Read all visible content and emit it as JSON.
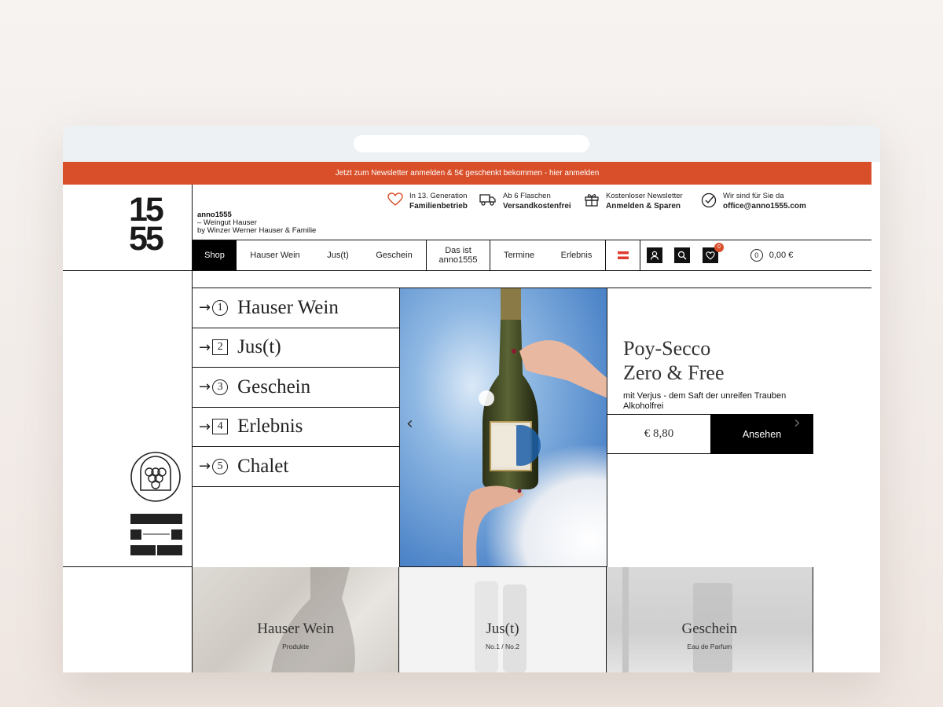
{
  "promo": {
    "text": "Jetzt zum Newsletter anmelden & 5€ geschenkt bekommen - hier anmelden"
  },
  "logo": {
    "line1": "15",
    "line2": "55"
  },
  "brand": {
    "line1": "anno1555",
    "line2": "– Weingut Hauser",
    "line3": "by Winzer Werner Hauser & Familie"
  },
  "usps": [
    {
      "icon": "heart-icon",
      "l1": "In 13. Generation",
      "l2": "Familienbetrieb"
    },
    {
      "icon": "truck-icon",
      "l1": "Ab 6 Flaschen",
      "l2": "Versandkostenfrei"
    },
    {
      "icon": "gift-icon",
      "l1": "Kostenloser Newsletter",
      "l2": "Anmelden & Sparen"
    },
    {
      "icon": "check-icon",
      "l1": "Wir sind für Sie da",
      "l2": "office@anno1555.com"
    }
  ],
  "nav": {
    "shop": "Shop",
    "hauser_wein": "Hauser Wein",
    "just": "Jus(t)",
    "geschein": "Geschein",
    "das_ist_1": "Das ist",
    "das_ist_2": "anno1555",
    "termine": "Termine",
    "erlebnis": "Erlebnis",
    "cart_count": "0",
    "cart_items": "0",
    "cart_total": "0,00 €"
  },
  "menu": [
    {
      "num": "1",
      "label": "Hauser Wein"
    },
    {
      "num": "2",
      "label": "Jus(t)"
    },
    {
      "num": "3",
      "label": "Geschein"
    },
    {
      "num": "4",
      "label": "Erlebnis"
    },
    {
      "num": "5",
      "label": "Chalet"
    }
  ],
  "product": {
    "title1": "Poy-Secco",
    "title2": "Zero & Free",
    "desc1": "mit Verjus - dem Saft der unreifen Trauben",
    "desc2": "Alkoholfrei",
    "price": "€ 8,80",
    "button": "Ansehen"
  },
  "cards": [
    {
      "title": "Hauser Wein",
      "sub": "Produkte"
    },
    {
      "title": "Jus(t)",
      "sub": "No.1 / No.2"
    },
    {
      "title": "Geschein",
      "sub": "Eau de Parfum"
    }
  ],
  "colors": {
    "accent": "#d94f2a",
    "ink": "#111111"
  }
}
